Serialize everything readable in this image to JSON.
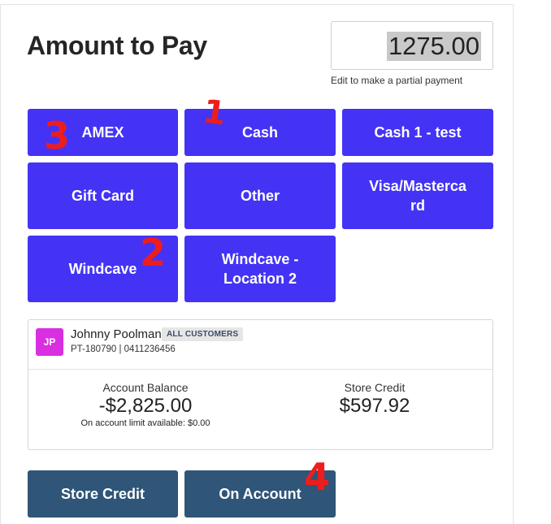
{
  "header": {
    "title": "Amount to Pay",
    "amount": "1275.00",
    "amount_hint": "Edit to make a partial payment"
  },
  "payment_methods": [
    {
      "label": "AMEX"
    },
    {
      "label": "Cash"
    },
    {
      "label": "Cash 1 - test"
    },
    {
      "label": "Gift Card"
    },
    {
      "label": "Other"
    },
    {
      "label": "Visa/Masterca\nrd"
    },
    {
      "label": "Windcave"
    },
    {
      "label": "Windcave -\nLocation 2"
    }
  ],
  "customer": {
    "initials": "JP",
    "name": "Johnny Poolman",
    "badge": "ALL CUSTOMERS",
    "details": "PT-180790 | 0411236456",
    "account_balance_label": "Account Balance",
    "account_balance_value": "-$2,825.00",
    "account_limit_note": "On account limit available: $0.00",
    "store_credit_label": "Store Credit",
    "store_credit_value": "$597.92"
  },
  "account_buttons": {
    "store_credit": "Store Credit",
    "on_account": "On Account"
  },
  "annotations": [
    "1",
    "2",
    "3",
    "4"
  ],
  "colors": {
    "payment_button": "#4433f5",
    "account_button": "#2f5578",
    "avatar": "#d82fe0",
    "annotation": "#ee1d1d"
  }
}
